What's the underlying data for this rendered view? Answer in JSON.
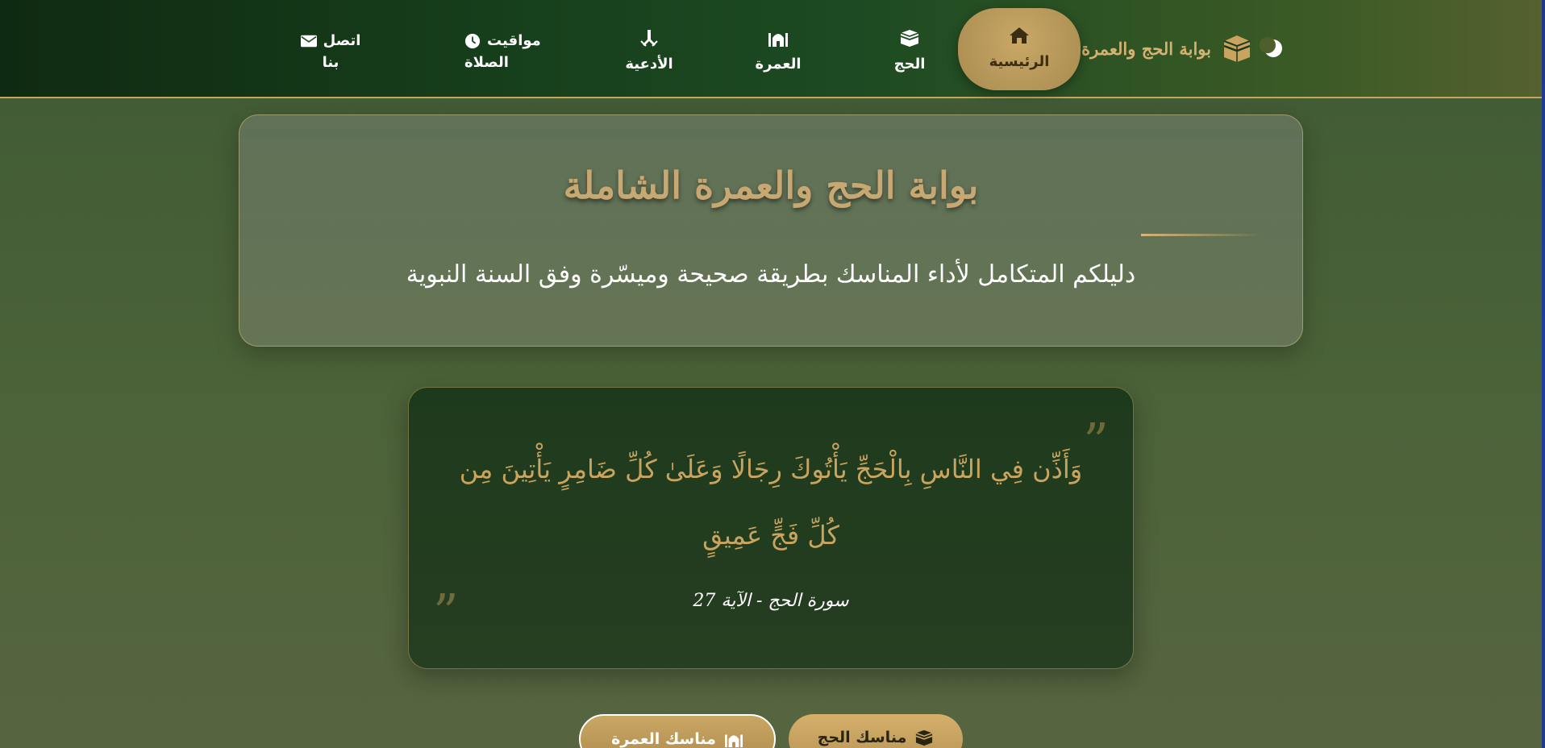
{
  "nav": {
    "brand": "بوابة الحج والعمرة",
    "items": [
      {
        "label": "الرئيسية",
        "icon": "home-icon",
        "active": true
      },
      {
        "label": "الحج",
        "icon": "kaaba-icon"
      },
      {
        "label": "العمرة",
        "icon": "mosque-icon"
      },
      {
        "label": "الأدعية",
        "icon": "praying-hands-icon"
      },
      {
        "label_line1": "مواقيت",
        "label_line2": "الصلاة",
        "icon": "clock-icon"
      },
      {
        "label_line1": "اتصل",
        "label_line2": "بنا",
        "icon": "envelope-icon"
      }
    ]
  },
  "hero": {
    "title": "بوابة الحج والعمرة الشاملة",
    "subtitle": "دليلكم المتكامل لأداء المناسك بطريقة صحيحة وميسّرة وفق السنة النبوية"
  },
  "quote": {
    "open_mark": "”",
    "close_mark": "”",
    "text": "وَأَذِّن فِي النَّاسِ بِالْحَجِّ يَأْتُوكَ رِجَالًا وَعَلَىٰ كُلِّ ضَامِرٍ يَأْتِينَ مِن كُلِّ فَجٍّ عَمِيقٍ",
    "source": "سورة الحج - الآية 27"
  },
  "buttons": {
    "hajj": "مناسك الحج",
    "umrah": "مناسك العمرة"
  },
  "colors": {
    "gold": "#c9a45f",
    "nav_dark_green": "#17401c",
    "quote_bg": "#1e3a1c"
  }
}
